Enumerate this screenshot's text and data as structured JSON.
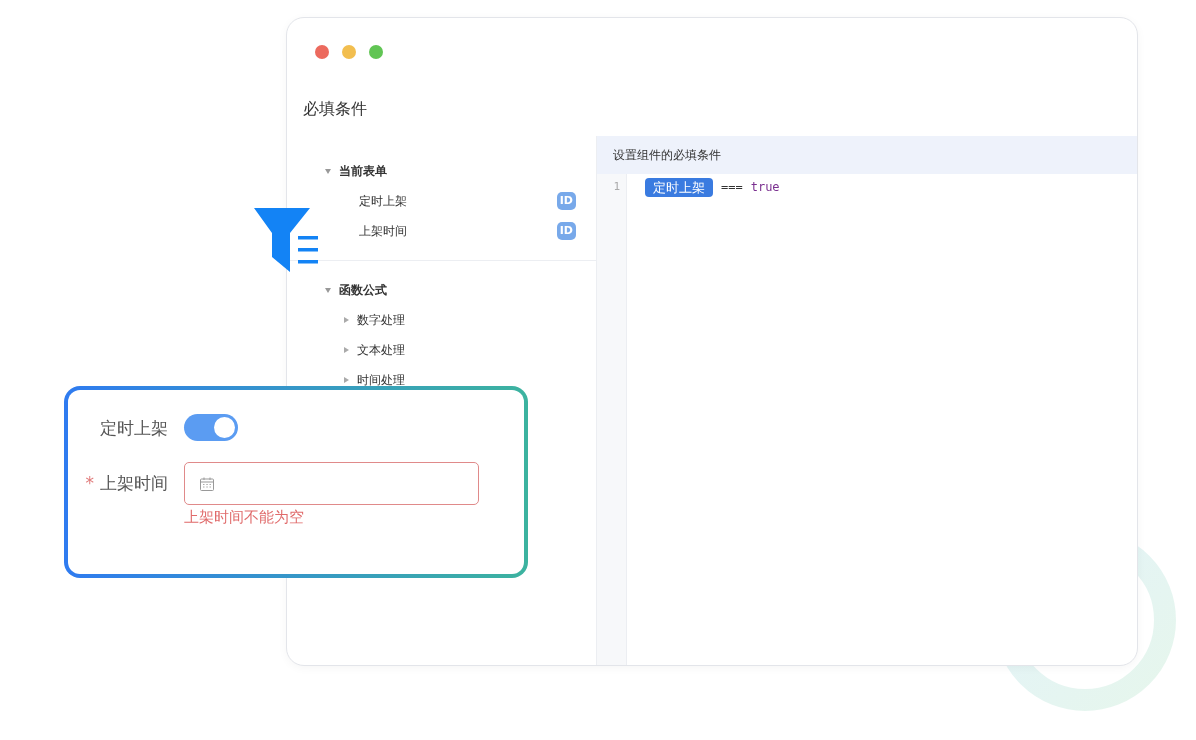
{
  "window": {
    "title": "必填条件"
  },
  "tree": [
    {
      "label": "当前表单",
      "expanded": true,
      "children": [
        {
          "label": "定时上架",
          "badge": "ID"
        },
        {
          "label": "上架时间",
          "badge": "ID"
        }
      ]
    },
    {
      "label": "函数公式",
      "expanded": true,
      "children": [
        {
          "label": "数字处理",
          "expanded": false
        },
        {
          "label": "文本处理",
          "expanded": false
        },
        {
          "label": "时间处理",
          "expanded": false
        }
      ]
    }
  ],
  "editor": {
    "title": "设置组件的必填条件",
    "lines": [
      {
        "number": "1",
        "tokens": [
          {
            "kind": "field",
            "text": "定时上架"
          },
          {
            "kind": "operator",
            "text": "==="
          },
          {
            "kind": "keyword",
            "text": "true"
          }
        ]
      }
    ]
  },
  "form": {
    "fields": [
      {
        "kind": "switch",
        "label": "定时上架",
        "required": false,
        "on": true
      },
      {
        "kind": "date",
        "label": "上架时间",
        "required": true,
        "required_mark": "*",
        "error": "上架时间不能为空"
      }
    ]
  }
}
